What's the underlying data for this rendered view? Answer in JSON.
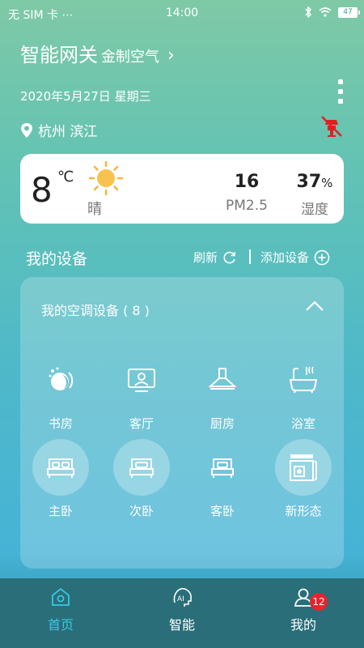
{
  "status_bar": {
    "carrier": "无 SIM 卡 ⋯",
    "time": "14:00",
    "battery": "47"
  },
  "header": {
    "title": "智能网关",
    "subtitle": "金制空气",
    "chevron": "›"
  },
  "date": {
    "text": "2020年5月27日  星期三"
  },
  "location": {
    "text": "杭州  滨江"
  },
  "weather": {
    "temperature": "8",
    "unit": "℃",
    "condition": "晴",
    "pm_value": "16",
    "pm_label": "PM2.5",
    "humidity_value": "37",
    "humidity_unit": "%",
    "humidity_label": "湿度"
  },
  "devices_section": {
    "title": "我的设备",
    "refresh_label": "刷新",
    "add_label": "添加设备"
  },
  "panel": {
    "title": "我的空调设备 ( 8 )",
    "rooms": [
      {
        "label": "书房",
        "icon": "scene-icon"
      },
      {
        "label": "客厅",
        "icon": "tv-icon"
      },
      {
        "label": "厨房",
        "icon": "range-hood-icon"
      },
      {
        "label": "浴室",
        "icon": "bathtub-icon"
      },
      {
        "label": "主卧",
        "icon": "bed-icon"
      },
      {
        "label": "次卧",
        "icon": "bed-icon"
      },
      {
        "label": "客卧",
        "icon": "bed-small-icon"
      },
      {
        "label": "新形态",
        "icon": "device-icon"
      }
    ]
  },
  "tabs": [
    {
      "label": "首页",
      "icon": "home-icon",
      "active": true
    },
    {
      "label": "智能",
      "icon": "ai-icon",
      "active": false
    },
    {
      "label": "我的",
      "icon": "user-icon",
      "active": false,
      "badge": "12"
    }
  ],
  "colors": {
    "accent": "#36c9e3",
    "tabbar": "#2a6e79",
    "badge": "#e8232e",
    "offline": "#e02020"
  }
}
